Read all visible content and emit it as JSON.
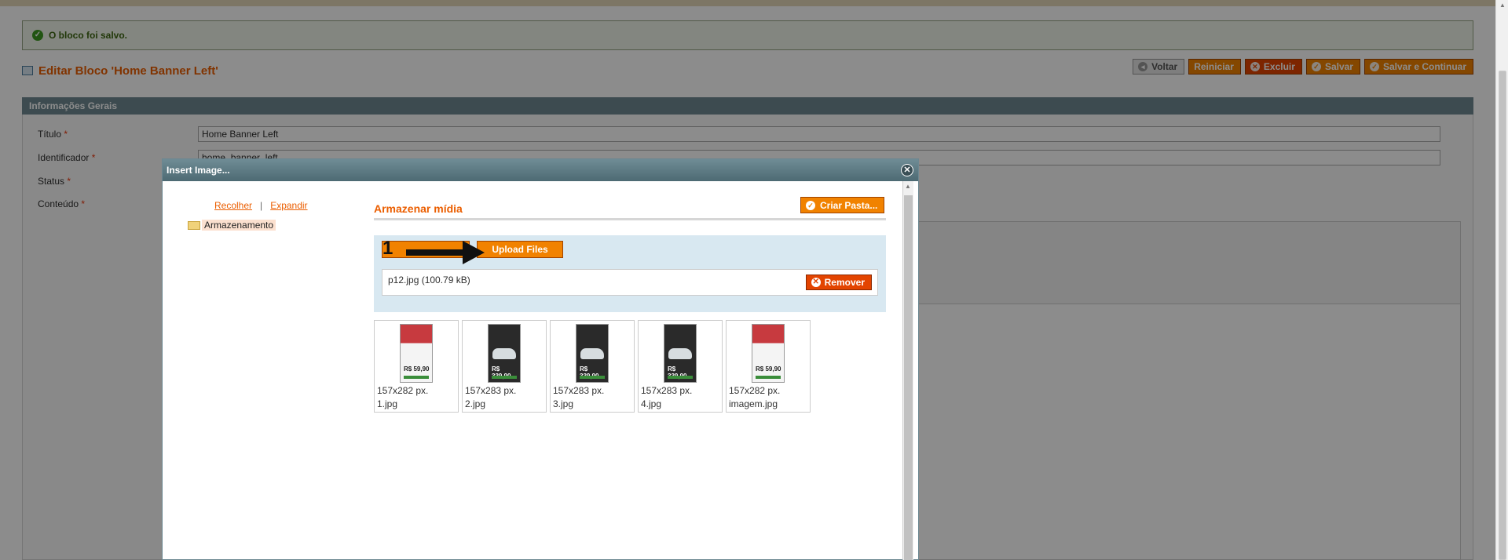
{
  "message": {
    "text": "O bloco foi salvo."
  },
  "page": {
    "title": "Editar Bloco 'Home Banner Left'"
  },
  "buttons": {
    "back": "Voltar",
    "reset": "Reiniciar",
    "delete": "Excluir",
    "save": "Salvar",
    "save_continue": "Salvar e Continuar"
  },
  "section": {
    "title": "Informações Gerais"
  },
  "form": {
    "title_label": "Título",
    "title_value": "Home Banner Left",
    "identifier_label": "Identificador",
    "identifier_value": "home_banner_left",
    "status_label": "Status",
    "content_label": "Conteúdo",
    "required_mark": "*"
  },
  "modal": {
    "title": "Insert Image...",
    "collapse": "Recolher",
    "separator": "|",
    "expand": "Expandir",
    "tree_root": "Armazenamento",
    "content_title": "Armazenar mídia",
    "new_folder": "Criar Pasta...",
    "browse_number": "1",
    "upload": "Upload Files",
    "file": "p12.jpg (100.79 kB)",
    "remove": "Remover",
    "images": [
      {
        "dims": "157x282 px.",
        "name": "1.jpg",
        "style": "red",
        "price": "R$ 59,90"
      },
      {
        "dims": "157x283 px.",
        "name": "2.jpg",
        "style": "dark",
        "price": "R$ 339,90"
      },
      {
        "dims": "157x283 px.",
        "name": "3.jpg",
        "style": "dark",
        "price": "R$ 339,90"
      },
      {
        "dims": "157x283 px.",
        "name": "4.jpg",
        "style": "dark",
        "price": "R$ 339,90"
      },
      {
        "dims": "157x282 px.",
        "name": "imagem.jpg",
        "style": "red",
        "price": "R$ 59,90"
      }
    ]
  },
  "colors": {
    "accent": "#f18200",
    "title_orange": "#eb5e00",
    "header_bar": "#6f8992",
    "danger": "#e34400"
  }
}
